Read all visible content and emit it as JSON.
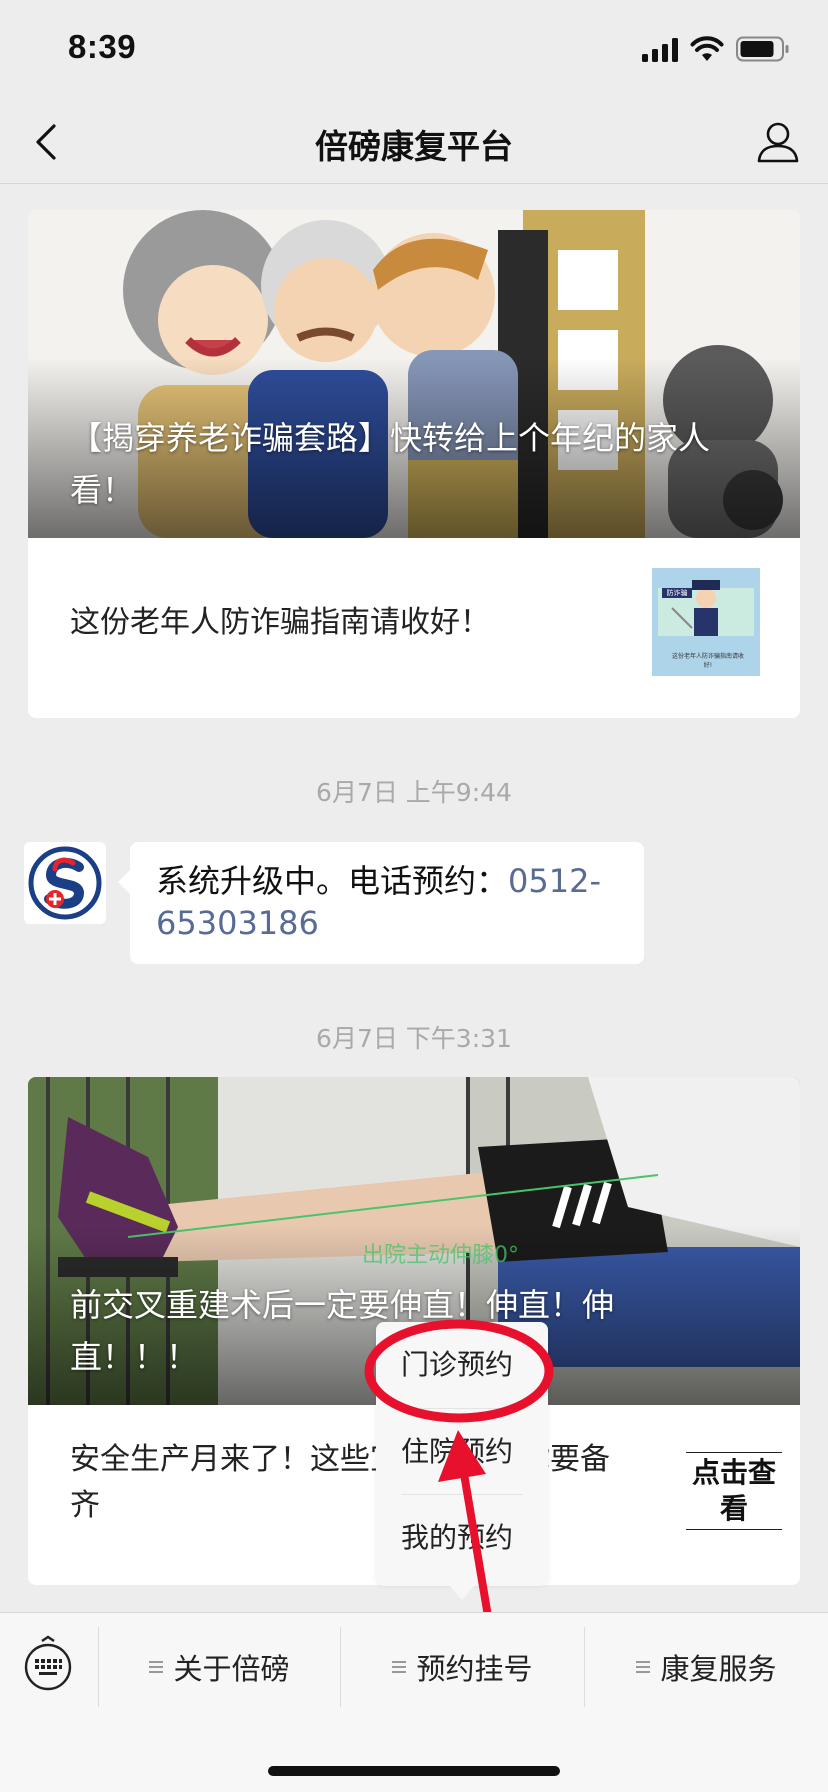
{
  "status_bar": {
    "time": "8:39"
  },
  "nav": {
    "title": "倍磅康复平台"
  },
  "article1": {
    "cover_title": "【揭穿养老诈骗套路】快转给上个年纪的家人看！",
    "subtitle": "这份老年人防诈骗指南请收好！",
    "thumb_banner": "防诈骗",
    "thumb_caption": "这份老年人防诈骗指南请收好!"
  },
  "timestamp1": "6月7日 上午9:44",
  "message": {
    "text": "系统升级中。电话预约：",
    "phone": "0512-65303186"
  },
  "timestamp2": "6月7日 下午3:31",
  "article2": {
    "cover_overlay": "出院主动伸膝0°",
    "cover_title": "前交叉重建术后一定要伸直！伸直！伸直！！！",
    "subtitle": "安全生产月来了！这些宣教素材，你要备齐",
    "click_view": "点击查看"
  },
  "popup_menu": {
    "items": [
      "门诊预约",
      "住院预约",
      "我的预约"
    ]
  },
  "bottom_menu": {
    "items": [
      "关于倍磅",
      "预约挂号",
      "康复服务"
    ]
  },
  "colors": {
    "link": "#576b95",
    "annotation": "#e8112d",
    "background": "#ededed"
  }
}
